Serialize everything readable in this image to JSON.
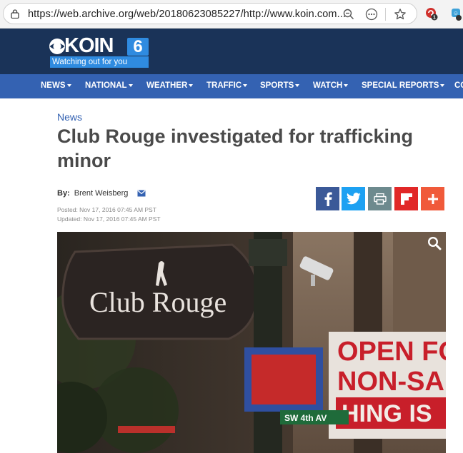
{
  "browser": {
    "url": "https://web.archive.org/web/20180623085227/http://www.koin.com...",
    "extension_badge": "1"
  },
  "site": {
    "logo_text": "KOIN",
    "logo_number": "6",
    "tagline": "Watching out for you"
  },
  "nav": {
    "items": [
      {
        "label": "NEWS"
      },
      {
        "label": "NATIONAL"
      },
      {
        "label": "WEATHER"
      },
      {
        "label": "TRAFFIC"
      },
      {
        "label": "SPORTS"
      },
      {
        "label": "WATCH"
      },
      {
        "label": "SPECIAL REPORTS"
      },
      {
        "label": "CO"
      }
    ]
  },
  "article": {
    "category": "News",
    "headline": "Club Rouge investigated for trafficking minor",
    "byline_label": "By:",
    "author": "Brent Weisberg",
    "posted": "Posted: Nov 17, 2016 07:45 AM PST",
    "updated": "Updated: Nov 17, 2016 07:45 AM PST"
  },
  "share": {
    "colors": {
      "facebook": "#3b5998",
      "twitter": "#1da1f2",
      "print": "#6d8a8e",
      "flipboard": "#e12828",
      "more": "#f05a3a"
    }
  },
  "photo": {
    "sign_text": "Club Rouge",
    "banner_line1": "OPEN FO",
    "banner_line2": "NON-SA",
    "banner_line3": "HING IS",
    "street_sign": "SW 4th AV"
  },
  "colors": {
    "header_bg": "#1a3358",
    "nav_bg": "#3462b2",
    "accent": "#2f8be0"
  }
}
